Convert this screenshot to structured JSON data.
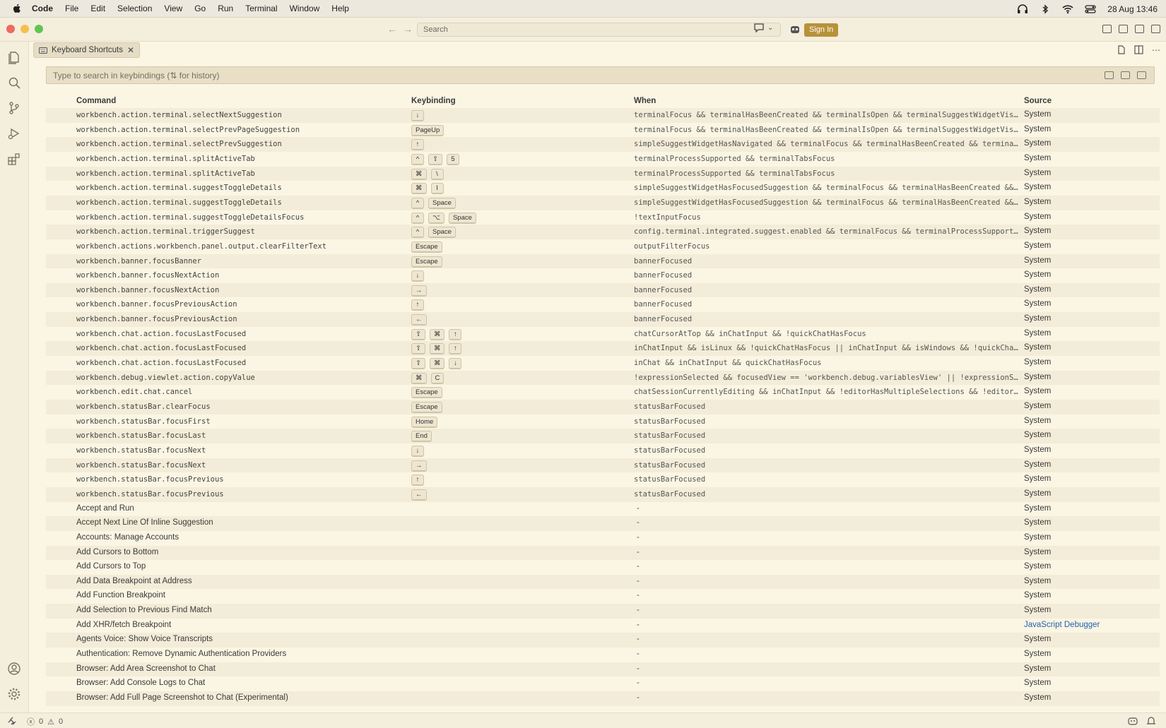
{
  "menubar": {
    "items": [
      "Code",
      "File",
      "Edit",
      "Selection",
      "View",
      "Go",
      "Run",
      "Terminal",
      "Window",
      "Help"
    ],
    "datetime": "28 Aug  13:46"
  },
  "titlebar": {
    "search_placeholder": "Search",
    "sign_in_label": "Sign In"
  },
  "tab": {
    "label": "Keyboard Shortcuts",
    "close": "✕"
  },
  "keybindings": {
    "search_placeholder": "Type to search in keybindings (⇅ for history)",
    "columns": {
      "command": "Command",
      "keybinding": "Keybinding",
      "when": "When",
      "source": "Source"
    },
    "rows": [
      {
        "command": "workbench.action.terminal.selectNextSuggestion",
        "keys": [
          "↓"
        ],
        "when": "terminalFocus && terminalHasBeenCreated && terminalIsOpen && terminalSuggestWidgetVisible...",
        "source": "System"
      },
      {
        "command": "workbench.action.terminal.selectPrevPageSuggestion",
        "keys": [
          "PageUp"
        ],
        "when": "terminalFocus && terminalHasBeenCreated && terminalIsOpen && terminalSuggestWidgetVisible...",
        "source": "System"
      },
      {
        "command": "workbench.action.terminal.selectPrevSuggestion",
        "keys": [
          "↑"
        ],
        "when": "simpleSuggestWidgetHasNavigated && terminalFocus && terminalHasBeenCreated && terminalIsO...",
        "source": "System"
      },
      {
        "command": "workbench.action.terminal.splitActiveTab",
        "keys": [
          "^",
          "⇧",
          "5"
        ],
        "when": "terminalProcessSupported && terminalTabsFocus",
        "source": "System"
      },
      {
        "command": "workbench.action.terminal.splitActiveTab",
        "keys": [
          "⌘",
          "\\"
        ],
        "when": "terminalProcessSupported && terminalTabsFocus",
        "source": "System"
      },
      {
        "command": "workbench.action.terminal.suggestToggleDetails",
        "keys": [
          "⌘",
          "I"
        ],
        "when": "simpleSuggestWidgetHasFocusedSuggestion && terminalFocus && terminalHasBeenCreated && ter...",
        "source": "System"
      },
      {
        "command": "workbench.action.terminal.suggestToggleDetails",
        "keys": [
          "^",
          "Space"
        ],
        "when": "simpleSuggestWidgetHasFocusedSuggestion && terminalFocus && terminalHasBeenCreated && ter...",
        "source": "System"
      },
      {
        "command": "workbench.action.terminal.suggestToggleDetailsFocus",
        "keys": [
          "^",
          "⌥",
          "Space"
        ],
        "when": "!textInputFocus",
        "source": "System"
      },
      {
        "command": "workbench.action.terminal.triggerSuggest",
        "keys": [
          "^",
          "Space"
        ],
        "when": "config.terminal.integrated.suggest.enabled && terminalFocus && terminalProcessSupported &...",
        "source": "System"
      },
      {
        "command": "workbench.actions.workbench.panel.output.clearFilterText",
        "keys": [
          "Escape"
        ],
        "when": "outputFilterFocus",
        "source": "System"
      },
      {
        "command": "workbench.banner.focusBanner",
        "keys": [
          "Escape"
        ],
        "when": "bannerFocused",
        "source": "System"
      },
      {
        "command": "workbench.banner.focusNextAction",
        "keys": [
          "↓"
        ],
        "when": "bannerFocused",
        "source": "System"
      },
      {
        "command": "workbench.banner.focusNextAction",
        "keys": [
          "→"
        ],
        "when": "bannerFocused",
        "source": "System"
      },
      {
        "command": "workbench.banner.focusPreviousAction",
        "keys": [
          "↑"
        ],
        "when": "bannerFocused",
        "source": "System"
      },
      {
        "command": "workbench.banner.focusPreviousAction",
        "keys": [
          "←"
        ],
        "when": "bannerFocused",
        "source": "System"
      },
      {
        "command": "workbench.chat.action.focusLastFocused",
        "keys": [
          "⇧",
          "⌘",
          "↑"
        ],
        "when": "chatCursorAtTop && inChatInput && !quickChatHasFocus",
        "source": "System"
      },
      {
        "command": "workbench.chat.action.focusLastFocused",
        "keys": [
          "⇧",
          "⌘",
          "↑"
        ],
        "when": "inChatInput && isLinux && !quickChatHasFocus || inChatInput && isWindows && !quickChatHas...",
        "source": "System"
      },
      {
        "command": "workbench.chat.action.focusLastFocused",
        "keys": [
          "⇧",
          "⌘",
          "↓"
        ],
        "when": "inChat && inChatInput && quickChatHasFocus",
        "source": "System"
      },
      {
        "command": "workbench.debug.viewlet.action.copyValue",
        "keys": [
          "⌘",
          "C"
        ],
        "when": "!expressionSelected && focusedView == 'workbench.debug.variablesView' || !expressionSelec...",
        "source": "System"
      },
      {
        "command": "workbench.edit.chat.cancel",
        "keys": [
          "Escape"
        ],
        "when": "chatSessionCurrentlyEditing && inChatInput && !editorHasMultipleSelections && !editorHasS...",
        "source": "System"
      },
      {
        "command": "workbench.statusBar.clearFocus",
        "keys": [
          "Escape"
        ],
        "when": "statusBarFocused",
        "source": "System"
      },
      {
        "command": "workbench.statusBar.focusFirst",
        "keys": [
          "Home"
        ],
        "when": "statusBarFocused",
        "source": "System"
      },
      {
        "command": "workbench.statusBar.focusLast",
        "keys": [
          "End"
        ],
        "when": "statusBarFocused",
        "source": "System"
      },
      {
        "command": "workbench.statusBar.focusNext",
        "keys": [
          "↓"
        ],
        "when": "statusBarFocused",
        "source": "System"
      },
      {
        "command": "workbench.statusBar.focusNext",
        "keys": [
          "→"
        ],
        "when": "statusBarFocused",
        "source": "System"
      },
      {
        "command": "workbench.statusBar.focusPrevious",
        "keys": [
          "↑"
        ],
        "when": "statusBarFocused",
        "source": "System"
      },
      {
        "command": "workbench.statusBar.focusPrevious",
        "keys": [
          "←"
        ],
        "when": "statusBarFocused",
        "source": "System"
      },
      {
        "label": "Accept and Run",
        "keys": [],
        "when": "-",
        "source": "System"
      },
      {
        "label": "Accept Next Line Of Inline Suggestion",
        "keys": [],
        "when": "-",
        "source": "System"
      },
      {
        "label": "Accounts: Manage Accounts",
        "keys": [],
        "when": "-",
        "source": "System"
      },
      {
        "label": "Add Cursors to Bottom",
        "keys": [],
        "when": "-",
        "source": "System"
      },
      {
        "label": "Add Cursors to Top",
        "keys": [],
        "when": "-",
        "source": "System"
      },
      {
        "label": "Add Data Breakpoint at Address",
        "keys": [],
        "when": "-",
        "source": "System"
      },
      {
        "label": "Add Function Breakpoint",
        "keys": [],
        "when": "-",
        "source": "System"
      },
      {
        "label": "Add Selection to Previous Find Match",
        "keys": [],
        "when": "-",
        "source": "System"
      },
      {
        "label": "Add XHR/fetch Breakpoint",
        "keys": [],
        "when": "-",
        "source": "JavaScript Debugger",
        "ext": true
      },
      {
        "label": "Agents Voice: Show Voice Transcripts",
        "keys": [],
        "when": "-",
        "source": "System"
      },
      {
        "label": "Authentication: Remove Dynamic Authentication Providers",
        "keys": [],
        "when": "-",
        "source": "System"
      },
      {
        "label": "Browser: Add Area Screenshot to Chat",
        "keys": [],
        "when": "-",
        "source": "System"
      },
      {
        "label": "Browser: Add Console Logs to Chat",
        "keys": [],
        "when": "-",
        "source": "System"
      },
      {
        "label": "Browser: Add Full Page Screenshot to Chat (Experimental)",
        "keys": [],
        "when": "-",
        "source": "System"
      }
    ]
  },
  "statusbar": {
    "errors": "0",
    "warnings": "0"
  },
  "colors": {
    "accent": "#b8923a",
    "link": "#2461b5",
    "background": "#fbf5e3"
  }
}
